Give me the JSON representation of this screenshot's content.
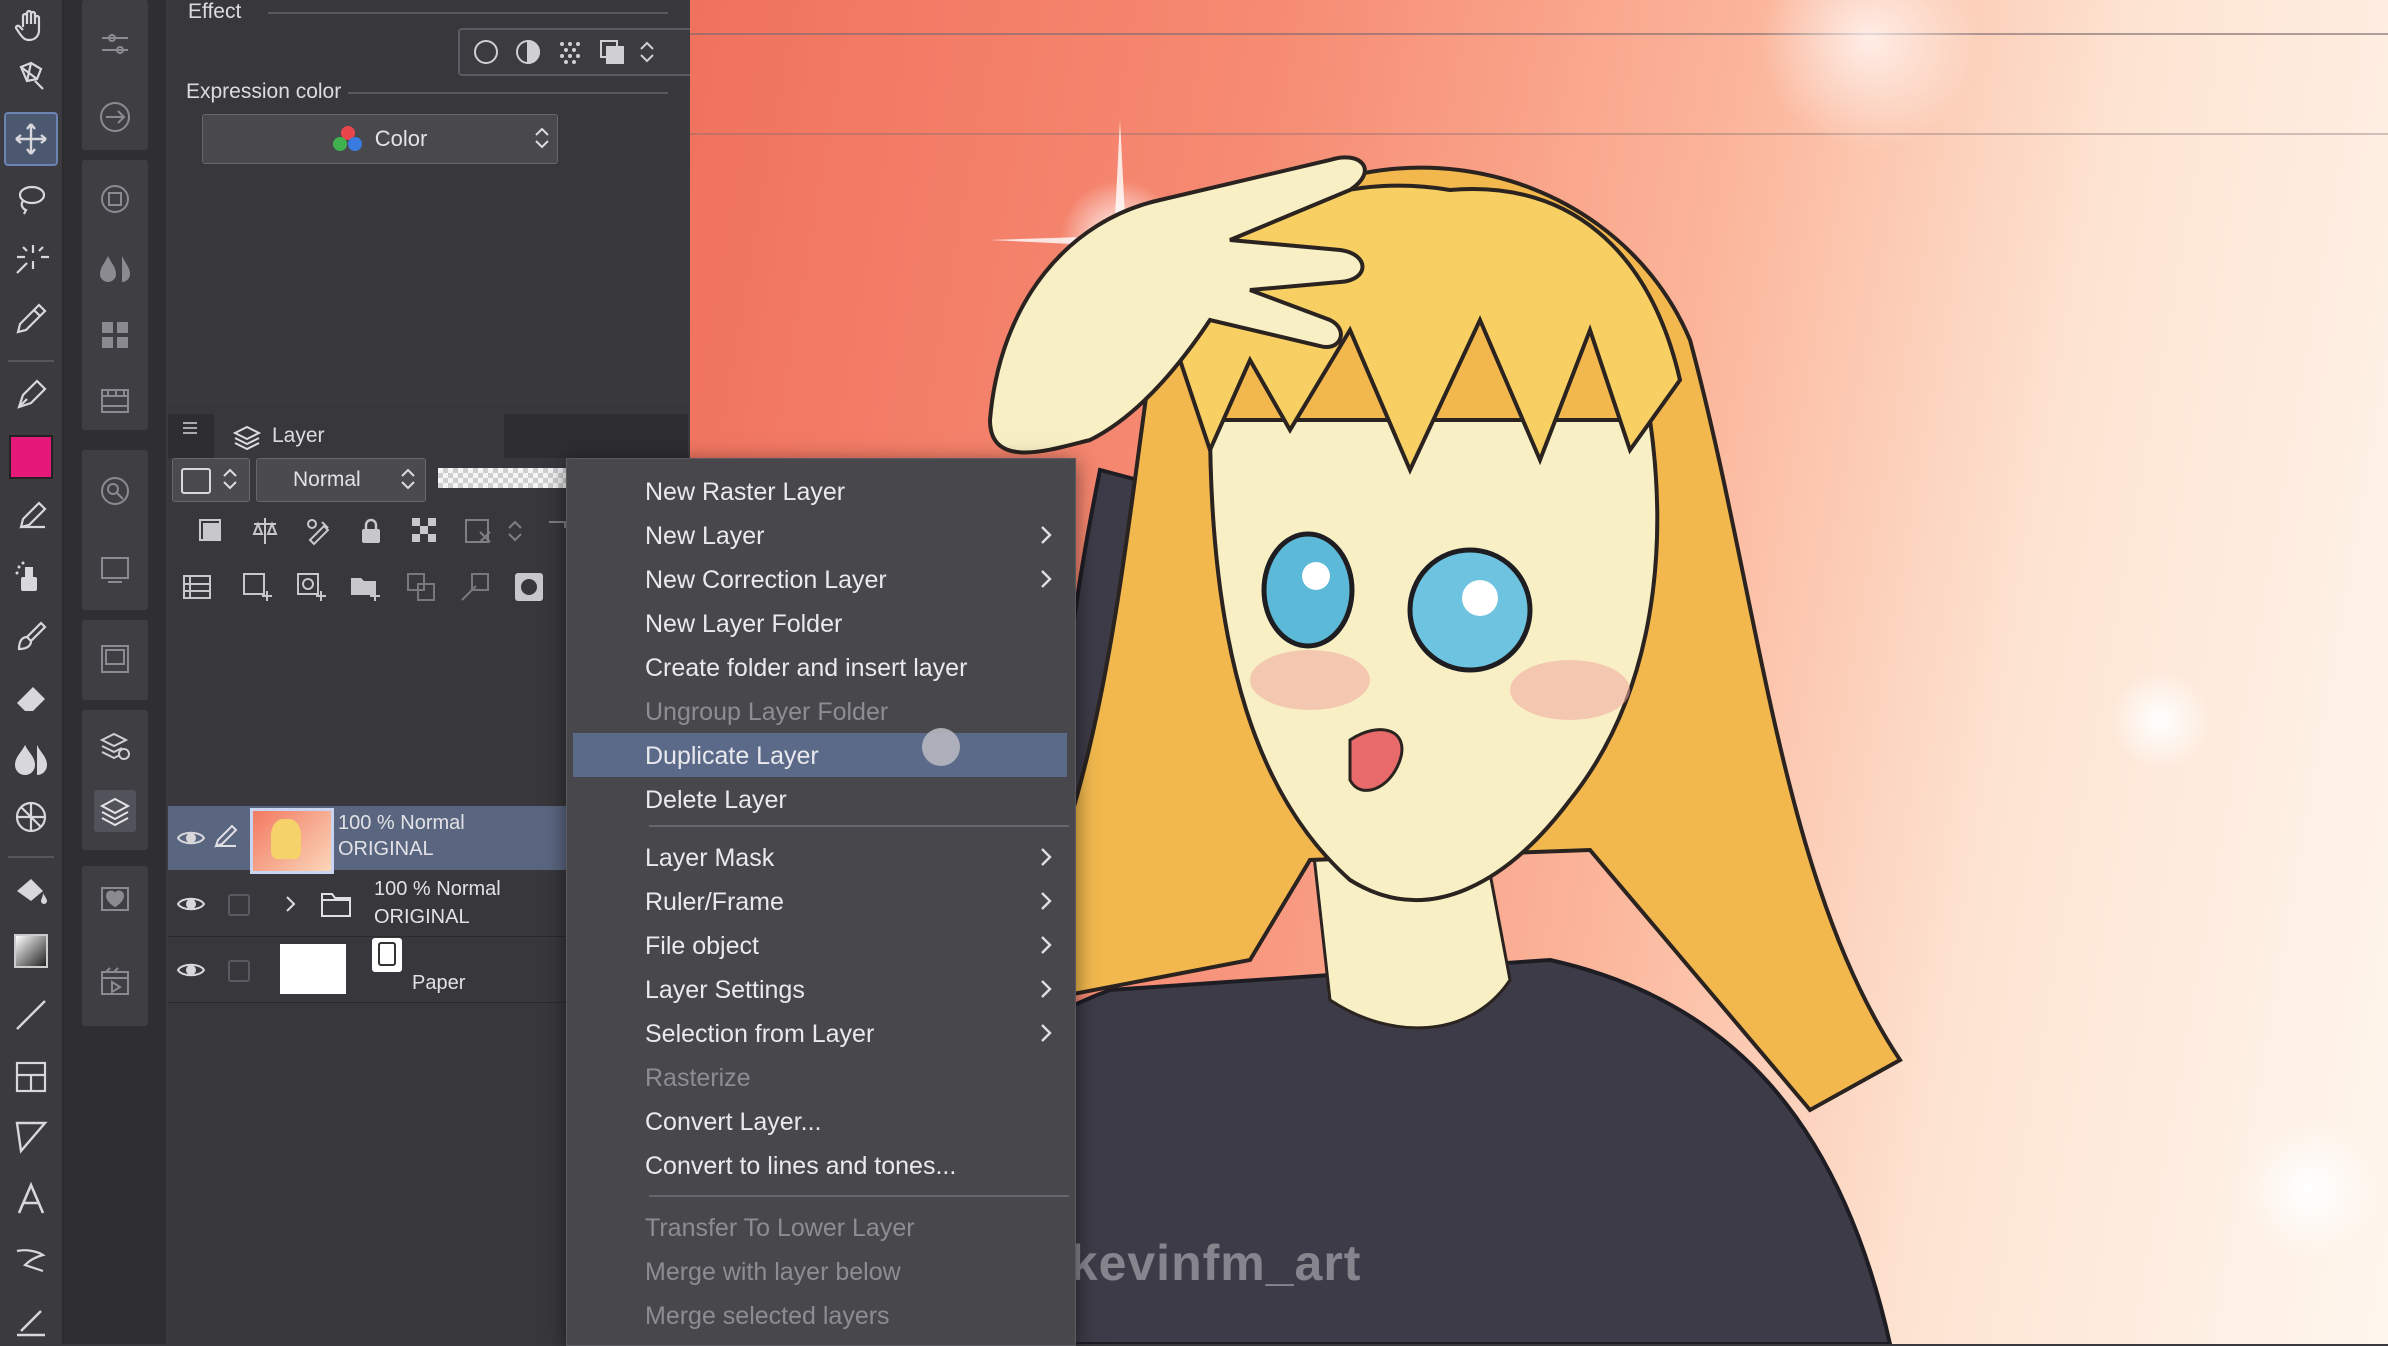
{
  "property_panel": {
    "effect_label": "Effect",
    "expression_color_label": "Expression color",
    "expression_color_value": "Color"
  },
  "layer_panel": {
    "tab_label": "Layer",
    "blend_mode": "Normal",
    "layers": [
      {
        "opacity_mode": "100 %  Normal",
        "name": "ORIGINAL",
        "selected": true,
        "type": "raster"
      },
      {
        "opacity_mode": "100 %  Normal",
        "name": "ORIGINAL",
        "selected": false,
        "type": "folder"
      },
      {
        "opacity_mode": "",
        "name": "Paper",
        "selected": false,
        "type": "paper"
      }
    ]
  },
  "context_menu": {
    "items": [
      {
        "label": "New Raster Layer",
        "submenu": false,
        "disabled": false
      },
      {
        "label": "New Layer",
        "submenu": true,
        "disabled": false
      },
      {
        "label": "New Correction Layer",
        "submenu": true,
        "disabled": false
      },
      {
        "label": "New Layer Folder",
        "submenu": false,
        "disabled": false
      },
      {
        "label": "Create folder and insert layer",
        "submenu": false,
        "disabled": false
      },
      {
        "label": "Ungroup Layer Folder",
        "submenu": false,
        "disabled": true
      },
      {
        "label": "Duplicate Layer",
        "submenu": false,
        "disabled": false,
        "highlighted": true
      },
      {
        "label": "Delete Layer",
        "submenu": false,
        "disabled": false
      },
      {
        "label": "Layer Mask",
        "submenu": true,
        "disabled": false
      },
      {
        "label": "Ruler/Frame",
        "submenu": true,
        "disabled": false
      },
      {
        "label": "File object",
        "submenu": true,
        "disabled": false
      },
      {
        "label": "Layer Settings",
        "submenu": true,
        "disabled": false
      },
      {
        "label": "Selection from Layer",
        "submenu": true,
        "disabled": false
      },
      {
        "label": "Rasterize",
        "submenu": false,
        "disabled": true
      },
      {
        "label": "Convert Layer...",
        "submenu": false,
        "disabled": false
      },
      {
        "label": "Convert to lines and tones...",
        "submenu": false,
        "disabled": false
      },
      {
        "label": "Transfer To Lower Layer",
        "submenu": false,
        "disabled": true
      },
      {
        "label": "Merge with layer below",
        "submenu": false,
        "disabled": true
      },
      {
        "label": "Merge selected layers",
        "submenu": false,
        "disabled": true
      }
    ]
  },
  "canvas": {
    "watermark": "@kevinfm_art"
  },
  "colors": {
    "main_color": "#e6197a",
    "menu_highlight": "#5c6a8a",
    "selected_layer": "#5a6680"
  },
  "tools": [
    "hand-icon",
    "zoom-icon",
    "move-icon",
    "lasso-icon",
    "magic-wand-icon",
    "eyedropper-icon",
    "pen-icon",
    "color-swatch",
    "pencil-icon",
    "airbrush-icon",
    "brush-icon",
    "eraser-icon",
    "blend-icon",
    "grid-icon",
    "fill-icon",
    "gradient-icon",
    "line-icon",
    "frame-icon",
    "ruler-icon",
    "text-icon",
    "balloon-icon",
    "correct-line-icon"
  ]
}
